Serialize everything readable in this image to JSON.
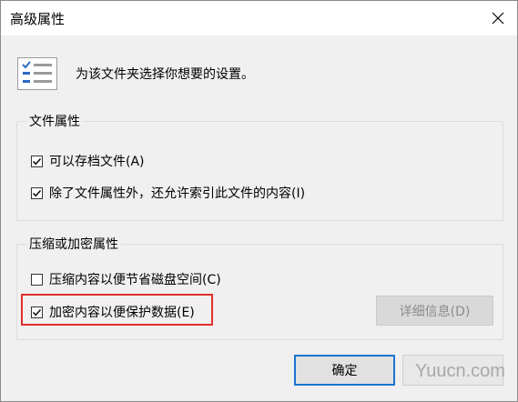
{
  "window": {
    "title": "高级属性"
  },
  "header": {
    "text": "为该文件夹选择你想要的设置。",
    "icon": "settings-list-icon"
  },
  "file_attributes": {
    "title": "文件属性",
    "archive": {
      "label": "可以存档文件(A)",
      "checked": true
    },
    "index": {
      "label": "除了文件属性外，还允许索引此文件的内容(I)",
      "checked": true
    }
  },
  "compress_encrypt": {
    "title": "压缩或加密属性",
    "compress": {
      "label": "压缩内容以便节省磁盘空间(C)",
      "checked": false
    },
    "encrypt": {
      "label": "加密内容以便保护数据(E)",
      "checked": true
    },
    "details_label": "详细信息(D)"
  },
  "buttons": {
    "ok": "确定",
    "cancel": ""
  },
  "watermark": "Yuucn.com",
  "colors": {
    "highlight": "#e0302a",
    "ok_border": "#1a74d0",
    "icon_blue": "#2b6cc4"
  }
}
